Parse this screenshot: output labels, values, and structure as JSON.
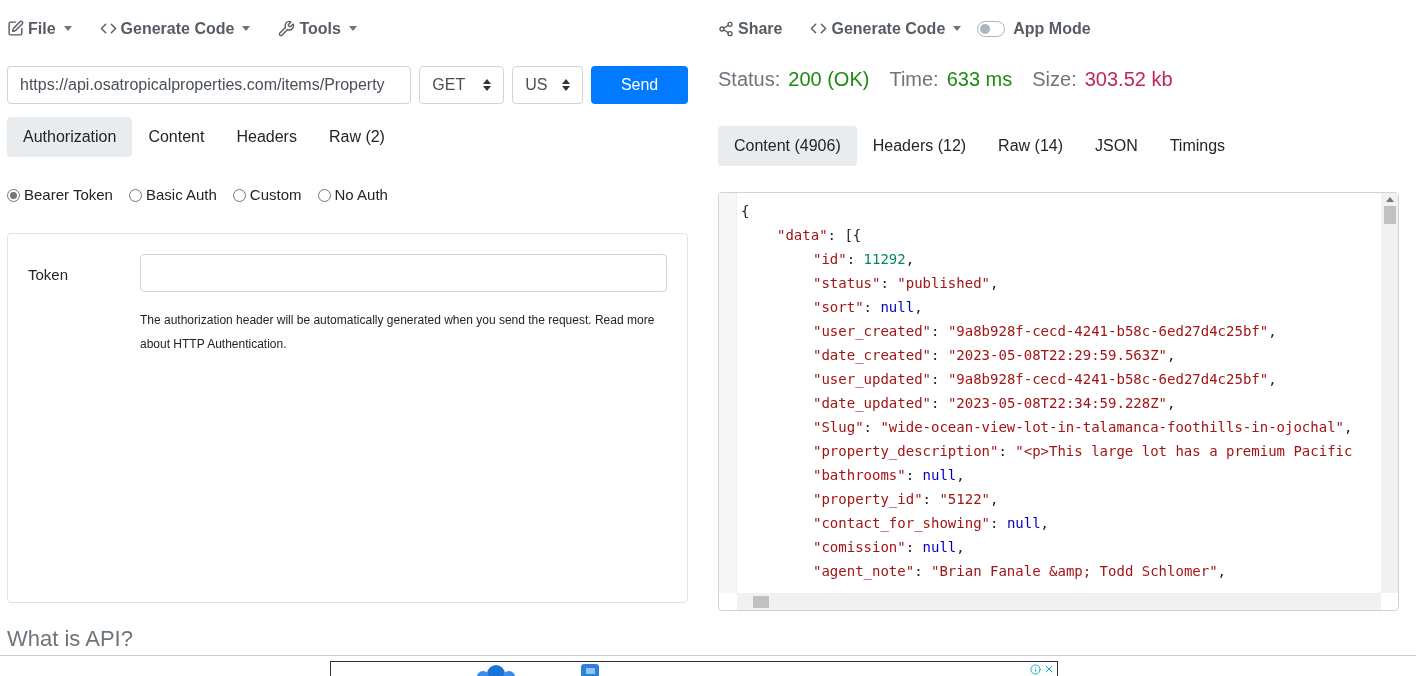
{
  "left_menu": [
    {
      "label": "File"
    },
    {
      "label": "Generate Code"
    },
    {
      "label": "Tools"
    }
  ],
  "request": {
    "url": "https://api.osatropicalproperties.com/items/Property",
    "method": "GET",
    "region": "US",
    "send": "Send"
  },
  "request_tabs": [
    {
      "label": "Authorization",
      "selected": true
    },
    {
      "label": "Content",
      "selected": false
    },
    {
      "label": "Headers",
      "selected": false
    },
    {
      "label": "Raw (2)",
      "selected": false
    }
  ],
  "auth_types": [
    {
      "label": "Bearer Token",
      "selected": true
    },
    {
      "label": "Basic Auth",
      "selected": false
    },
    {
      "label": "Custom",
      "selected": false
    },
    {
      "label": "No Auth",
      "selected": false
    }
  ],
  "token": {
    "label": "Token",
    "help": "The authorization header will be automatically generated when you send the request. Read more about HTTP Authentication."
  },
  "right_menu": {
    "share": "Share",
    "generate": "Generate Code",
    "app_mode": {
      "label": "App Mode",
      "on": false
    }
  },
  "stats": [
    {
      "label": "Status:",
      "value": "200 (OK)",
      "color": "#1e8a12"
    },
    {
      "label": "Time:",
      "value": "633 ms",
      "color": "#1e8a12"
    },
    {
      "label": "Size:",
      "value": "303.52 kb",
      "color": "#c0265a"
    }
  ],
  "response_tabs": [
    {
      "label": "Content (4906)",
      "selected": true
    },
    {
      "label": "Headers (12)",
      "selected": false
    },
    {
      "label": "Raw (14)",
      "selected": false
    },
    {
      "label": "JSON",
      "selected": false
    },
    {
      "label": "Timings",
      "selected": false
    }
  ],
  "code": [
    {
      "tokens": [
        {
          "kind": "punct",
          "text": "{"
        }
      ],
      "children": [
        {
          "tokens": [
            {
              "kind": "key",
              "text": "\"data\""
            },
            {
              "kind": "punct",
              "text": ": [{"
            }
          ],
          "children": [
            {
              "tokens": [
                {
                  "kind": "key",
                  "text": "\"id\""
                },
                {
                  "kind": "punct",
                  "text": ": "
                },
                {
                  "kind": "number",
                  "text": "11292"
                },
                {
                  "kind": "punct",
                  "text": ","
                }
              ]
            },
            {
              "tokens": [
                {
                  "kind": "key",
                  "text": "\"status\""
                },
                {
                  "kind": "punct",
                  "text": ": "
                },
                {
                  "kind": "string",
                  "text": "\"published\""
                },
                {
                  "kind": "punct",
                  "text": ","
                }
              ]
            },
            {
              "tokens": [
                {
                  "kind": "key",
                  "text": "\"sort\""
                },
                {
                  "kind": "punct",
                  "text": ": "
                },
                {
                  "kind": "null",
                  "text": "null"
                },
                {
                  "kind": "punct",
                  "text": ","
                }
              ]
            },
            {
              "tokens": [
                {
                  "kind": "key",
                  "text": "\"user_created\""
                },
                {
                  "kind": "punct",
                  "text": ": "
                },
                {
                  "kind": "string",
                  "text": "\"9a8b928f-cecd-4241-b58c-6ed27d4c25bf\""
                },
                {
                  "kind": "punct",
                  "text": ","
                }
              ]
            },
            {
              "tokens": [
                {
                  "kind": "key",
                  "text": "\"date_created\""
                },
                {
                  "kind": "punct",
                  "text": ": "
                },
                {
                  "kind": "string",
                  "text": "\"2023-05-08T22:29:59.563Z\""
                },
                {
                  "kind": "punct",
                  "text": ","
                }
              ]
            },
            {
              "tokens": [
                {
                  "kind": "key",
                  "text": "\"user_updated\""
                },
                {
                  "kind": "punct",
                  "text": ": "
                },
                {
                  "kind": "string",
                  "text": "\"9a8b928f-cecd-4241-b58c-6ed27d4c25bf\""
                },
                {
                  "kind": "punct",
                  "text": ","
                }
              ]
            },
            {
              "tokens": [
                {
                  "kind": "key",
                  "text": "\"date_updated\""
                },
                {
                  "kind": "punct",
                  "text": ": "
                },
                {
                  "kind": "string",
                  "text": "\"2023-05-08T22:34:59.228Z\""
                },
                {
                  "kind": "punct",
                  "text": ","
                }
              ]
            },
            {
              "tokens": [
                {
                  "kind": "key",
                  "text": "\"Slug\""
                },
                {
                  "kind": "punct",
                  "text": ": "
                },
                {
                  "kind": "string",
                  "text": "\"wide-ocean-view-lot-in-talamanca-foothills-in-ojochal\""
                },
                {
                  "kind": "punct",
                  "text": ","
                }
              ]
            },
            {
              "tokens": [
                {
                  "kind": "key",
                  "text": "\"property_description\""
                },
                {
                  "kind": "punct",
                  "text": ": "
                },
                {
                  "kind": "string",
                  "text": "\"<p>This large lot has a premium Pacific"
                }
              ]
            },
            {
              "tokens": [
                {
                  "kind": "key",
                  "text": "\"bathrooms\""
                },
                {
                  "kind": "punct",
                  "text": ": "
                },
                {
                  "kind": "null",
                  "text": "null"
                },
                {
                  "kind": "punct",
                  "text": ","
                }
              ]
            },
            {
              "tokens": [
                {
                  "kind": "key",
                  "text": "\"property_id\""
                },
                {
                  "kind": "punct",
                  "text": ": "
                },
                {
                  "kind": "string",
                  "text": "\"5122\""
                },
                {
                  "kind": "punct",
                  "text": ","
                }
              ]
            },
            {
              "tokens": [
                {
                  "kind": "key",
                  "text": "\"contact_for_showing\""
                },
                {
                  "kind": "punct",
                  "text": ": "
                },
                {
                  "kind": "null",
                  "text": "null"
                },
                {
                  "kind": "punct",
                  "text": ","
                }
              ]
            },
            {
              "tokens": [
                {
                  "kind": "key",
                  "text": "\"comission\""
                },
                {
                  "kind": "punct",
                  "text": ": "
                },
                {
                  "kind": "null",
                  "text": "null"
                },
                {
                  "kind": "punct",
                  "text": ","
                }
              ]
            },
            {
              "tokens": [
                {
                  "kind": "key",
                  "text": "\"agent_note\""
                },
                {
                  "kind": "punct",
                  "text": ": "
                },
                {
                  "kind": "string",
                  "text": "\"Brian Fanale &amp; Todd Schlomer\""
                },
                {
                  "kind": "punct",
                  "text": ","
                }
              ]
            }
          ]
        }
      ]
    }
  ],
  "article": {
    "heading": "What is API?"
  }
}
